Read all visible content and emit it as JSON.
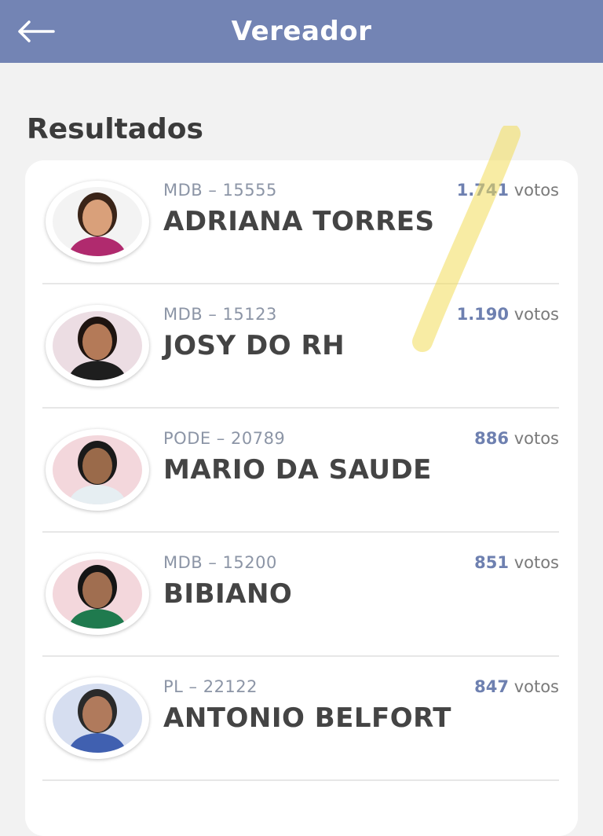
{
  "header": {
    "title": "Vereador",
    "back_icon": "arrow-left-icon"
  },
  "section": {
    "title": "Resultados"
  },
  "candidates": [
    {
      "party": "MDB – 15555",
      "votes_num": "1.741",
      "votes_suffix": " votos",
      "name": "ADRIANA TORRES",
      "photo_bg": "#f3f3f3",
      "hair": "#3a2418",
      "skin": "#d9a07a",
      "shirt": "#b02a6e"
    },
    {
      "party": "MDB – 15123",
      "votes_num": "1.190",
      "votes_suffix": " votos",
      "name": "JOSY DO RH",
      "photo_bg": "#ecdde3",
      "hair": "#1e1410",
      "skin": "#b47a58",
      "shirt": "#1e1e1e"
    },
    {
      "party": "PODE – 20789",
      "votes_num": "886",
      "votes_suffix": " votos",
      "name": "MARIO DA SAUDE",
      "photo_bg": "#f3d7dc",
      "hair": "#1a1a1a",
      "skin": "#9a6a4a",
      "shirt": "#e6eef2"
    },
    {
      "party": "MDB – 15200",
      "votes_num": "851",
      "votes_suffix": " votos",
      "name": "BIBIANO",
      "photo_bg": "#f3d7dc",
      "hair": "#151515",
      "skin": "#a06e50",
      "shirt": "#1f7a4e"
    },
    {
      "party": "PL – 22122",
      "votes_num": "847",
      "votes_suffix": " votos",
      "name": "ANTONIO BELFORT",
      "photo_bg": "#d6def0",
      "hair": "#2a2a2a",
      "skin": "#b07a5c",
      "shirt": "#4060b0"
    }
  ]
}
